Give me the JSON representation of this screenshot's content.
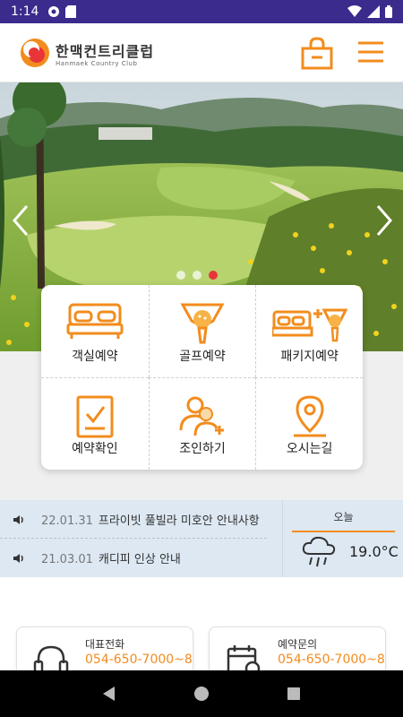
{
  "status_bar": {
    "time": "1:14"
  },
  "header": {
    "logo_title": "한맥컨트리클럽",
    "logo_subtitle": "Hanmaek Country Club"
  },
  "hero": {
    "slide_count": 3,
    "active_slide": 3
  },
  "menu": {
    "items": [
      {
        "label": "객실예약",
        "icon": "bed-icon"
      },
      {
        "label": "골프예약",
        "icon": "golf-ball-tee-icon"
      },
      {
        "label": "패키지예약",
        "icon": "package-bed-golf-icon"
      },
      {
        "label": "예약확인",
        "icon": "reservation-check-icon"
      },
      {
        "label": "조인하기",
        "icon": "join-people-icon"
      },
      {
        "label": "오시는길",
        "icon": "location-pin-icon"
      }
    ]
  },
  "notices": [
    {
      "date": "22.01.31",
      "title": "프라이빗 풀빌라 미호안 안내사항"
    },
    {
      "date": "21.03.01",
      "title": "캐디피 인상 안내"
    }
  ],
  "weather": {
    "label": "오늘",
    "temperature": "19.0°C",
    "icon": "cloud-rain-icon"
  },
  "contacts": [
    {
      "label": "대표전화",
      "number": "054-650-7000~8",
      "icon": "headset-icon"
    },
    {
      "label": "예약문의",
      "number": "054-650-7000~8",
      "icon": "calendar-clock-icon"
    }
  ],
  "colors": {
    "accent": "#f28c1e",
    "status_bar": "#3a2b8c",
    "notice_bg": "#dde8f3",
    "slide_active": "#e8353a"
  }
}
